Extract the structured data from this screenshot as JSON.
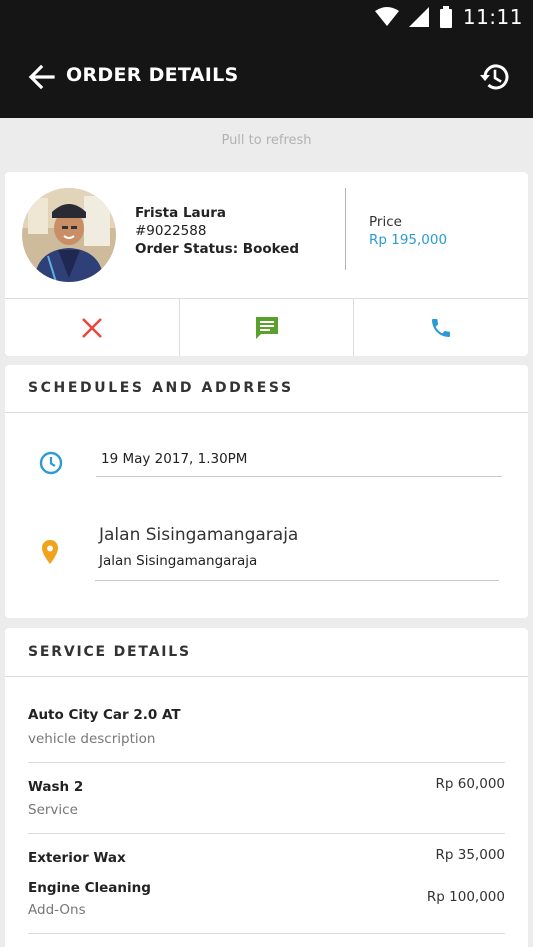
{
  "status_bar": {
    "time": "11:11"
  },
  "app_bar": {
    "title": "ORDER DETAILS"
  },
  "refresh_text": "Pull to refresh",
  "profile": {
    "name": "Frista Laura",
    "order_id": "#9022588",
    "status": "Order Status: Booked",
    "price_label": "Price",
    "price_value": "Rp 195,000"
  },
  "schedule": {
    "title": "SCHEDULES AND ADDRESS",
    "datetime": "19 May 2017, 1.30PM",
    "address_main": "Jalan Sisingamangaraja",
    "address_sub": "Jalan Sisingamangaraja"
  },
  "service": {
    "title": "SERVICE DETAILS",
    "vehicle_name": "Auto City Car 2.0 AT",
    "vehicle_desc": "vehicle description",
    "service_name": "Wash 2",
    "service_type": "Service",
    "service_price": "Rp 60,000",
    "addon1_name": "Exterior Wax",
    "addon1_price": "Rp 35,000",
    "addon2_name": "Engine Cleaning",
    "addon2_price": "Rp 100,000",
    "addon_type": "Add-Ons"
  },
  "colors": {
    "appbar": "#151515",
    "accent_blue": "#2c9ad6",
    "cancel_red": "#e8473d",
    "chat_green": "#5aa02c",
    "pin_orange": "#f0a21a"
  },
  "icons": {
    "back": "arrow-back-icon",
    "history": "history-icon",
    "cancel": "close-icon",
    "chat": "chat-icon",
    "call": "phone-icon",
    "clock": "clock-icon",
    "location": "location-pin-icon"
  }
}
